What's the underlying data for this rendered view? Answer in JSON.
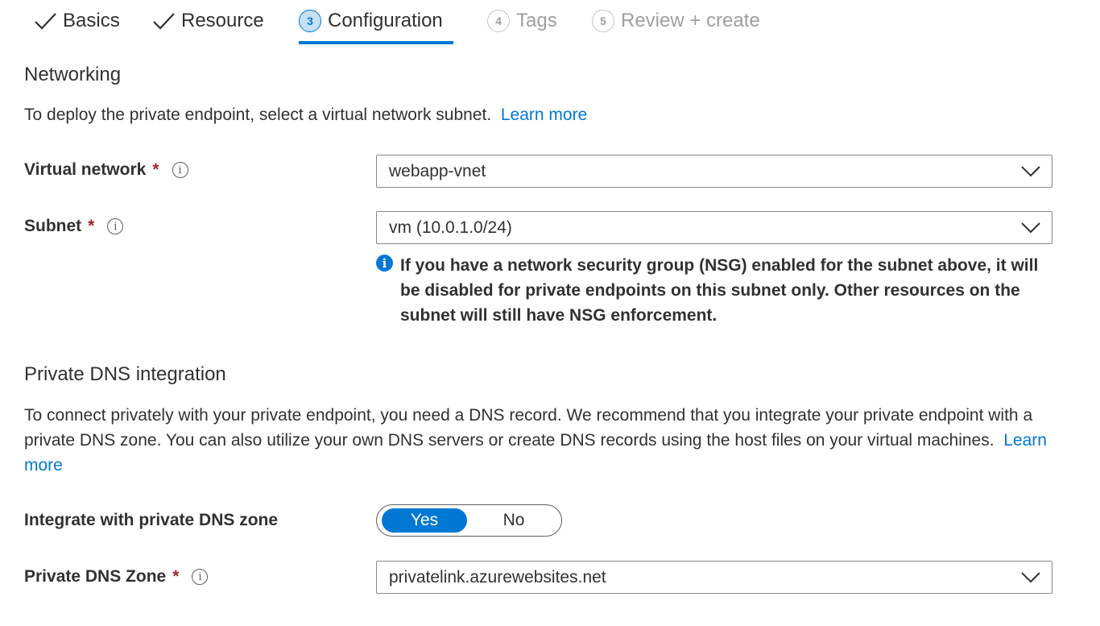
{
  "tabs": [
    {
      "label": "Basics",
      "state": "done"
    },
    {
      "label": "Resource",
      "state": "done"
    },
    {
      "number": "3",
      "label": "Configuration",
      "state": "active"
    },
    {
      "number": "4",
      "label": "Tags",
      "state": "pending"
    },
    {
      "number": "5",
      "label": "Review + create",
      "state": "pending"
    }
  ],
  "networking": {
    "title": "Networking",
    "description": "To deploy the private endpoint, select a virtual network subnet.",
    "learn_more": "Learn more",
    "virtual_network": {
      "label": "Virtual network",
      "required": "*",
      "value": "webapp-vnet"
    },
    "subnet": {
      "label": "Subnet",
      "required": "*",
      "value": "vm (10.0.1.0/24)"
    },
    "nsg_note": "If you have a network security group (NSG) enabled for the subnet above, it will be disabled for private endpoints on this subnet only. Other resources on the subnet will still have NSG enforcement."
  },
  "dns": {
    "title": "Private DNS integration",
    "description": "To connect privately with your private endpoint, you need a DNS record. We recommend that you integrate your private endpoint with a private DNS zone. You can also utilize your own DNS servers or create DNS records using the host files on your virtual machines.",
    "learn_more": "Learn more",
    "integrate": {
      "label": "Integrate with private DNS zone",
      "yes": "Yes",
      "no": "No",
      "selected": "Yes"
    },
    "zone": {
      "label": "Private DNS Zone",
      "required": "*",
      "value": "privatelink.azurewebsites.net"
    }
  },
  "colors": {
    "accent": "#0078d4",
    "required": "#a4262c",
    "text": "#323130",
    "muted": "#a19f9d"
  },
  "icons": {
    "done": "checkmark-icon",
    "info": "info-icon",
    "dropdown": "chevron-down-icon"
  }
}
